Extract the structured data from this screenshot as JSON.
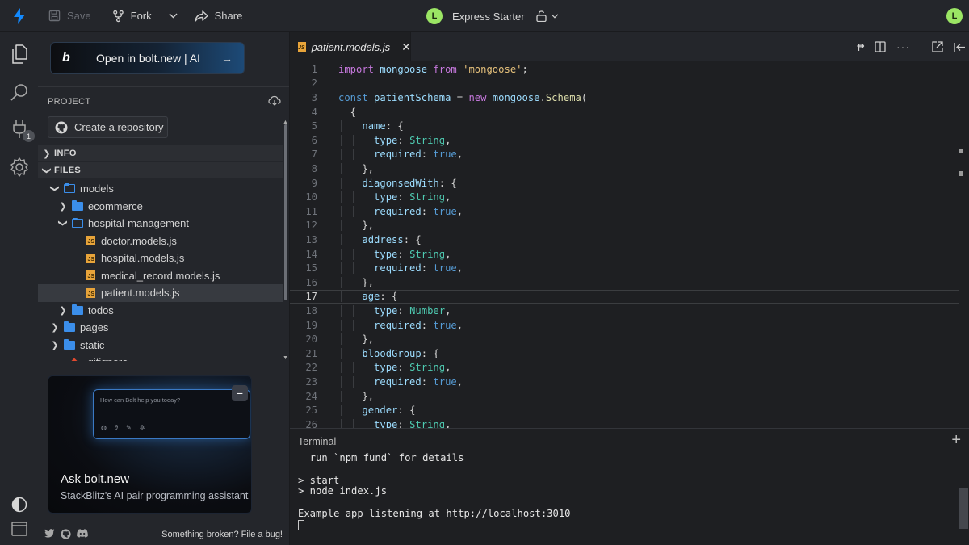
{
  "topbar": {
    "save_label": "Save",
    "fork_label": "Fork",
    "share_label": "Share",
    "project_title": "Express Starter",
    "user_initial": "L",
    "accent": "#9be564"
  },
  "sidebar": {
    "bolt_button_label": "Open in bolt.new | AI",
    "bolt_logo": "b",
    "project_label": "PROJECT",
    "create_repo_label": "Create a repository",
    "info_label": "INFO",
    "files_label": "FILES",
    "tree": [
      {
        "name": "models",
        "type": "folder",
        "open": true,
        "depth": 0
      },
      {
        "name": "ecommerce",
        "type": "folder",
        "open": false,
        "depth": 1
      },
      {
        "name": "hospital-management",
        "type": "folder",
        "open": true,
        "depth": 1
      },
      {
        "name": "doctor.models.js",
        "type": "js",
        "depth": 2
      },
      {
        "name": "hospital.models.js",
        "type": "js",
        "depth": 2
      },
      {
        "name": "medical_record.models.js",
        "type": "js",
        "depth": 2
      },
      {
        "name": "patient.models.js",
        "type": "js",
        "depth": 2,
        "selected": true
      },
      {
        "name": "todos",
        "type": "folder",
        "open": false,
        "depth": 1
      },
      {
        "name": "pages",
        "type": "folder",
        "open": false,
        "depth": 0
      },
      {
        "name": "static",
        "type": "folder",
        "open": false,
        "depth": 0
      },
      {
        "name": ".gitignore",
        "type": "git",
        "depth": 0
      }
    ],
    "promo": {
      "placeholder": "How can Bolt help you today?",
      "title": "Ask bolt.new",
      "subtitle": "StackBlitz's AI pair programming assistant",
      "close_label": "−"
    },
    "bug_link": "Something broken? File a bug!",
    "badge_count": "1"
  },
  "editor": {
    "tab_label": "patient.models.js",
    "active_line": 17,
    "lines": [
      "import mongoose from 'mongoose';",
      "",
      "const patientSchema = new mongoose.Schema(",
      "  {",
      "    name: {",
      "      type: String,",
      "      required: true,",
      "    },",
      "    diagonsedWith: {",
      "      type: String,",
      "      required: true,",
      "    },",
      "    address: {",
      "      type: String,",
      "      required: true,",
      "    },",
      "    age: {",
      "      type: Number,",
      "      required: true,",
      "    },",
      "    bloodGroup: {",
      "      type: String,",
      "      required: true,",
      "    },",
      "    gender: {",
      "      type: String,"
    ]
  },
  "terminal": {
    "title": "Terminal",
    "lines": [
      "  run `npm fund` for details",
      "",
      "> start",
      "> node index.js",
      "",
      "Example app listening at http://localhost:3010"
    ]
  }
}
